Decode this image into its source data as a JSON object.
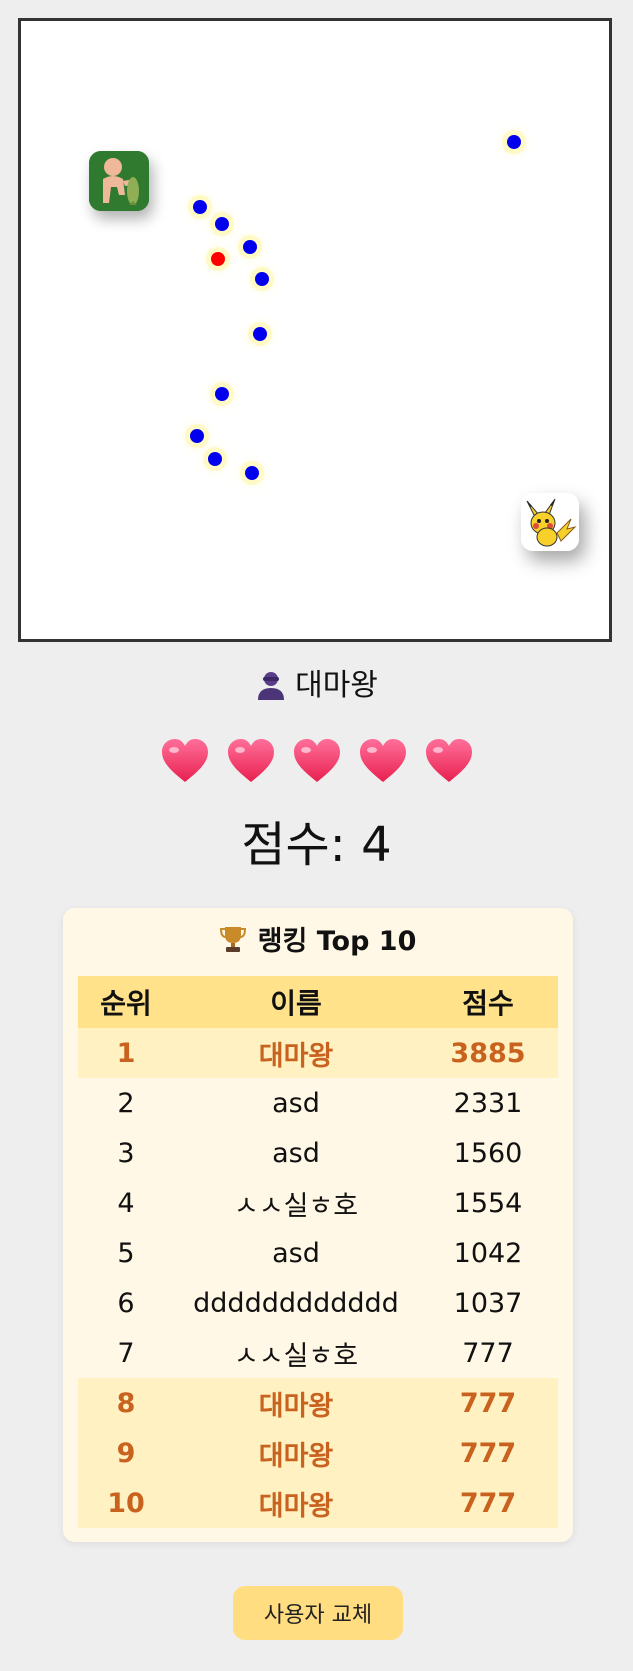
{
  "game": {
    "dots": [
      {
        "color": "blue"
      },
      {
        "color": "blue"
      },
      {
        "color": "blue"
      },
      {
        "color": "red"
      },
      {
        "color": "blue"
      },
      {
        "color": "blue"
      },
      {
        "color": "blue"
      },
      {
        "color": "blue"
      },
      {
        "color": "blue"
      },
      {
        "color": "blue"
      },
      {
        "color": "blue"
      },
      {
        "color": "blue"
      }
    ],
    "enemy_icon": "muscle-man-with-fish-icon",
    "player_icon": "pikachu-icon"
  },
  "user": {
    "icon": "user-silhouette-icon",
    "name": "대마왕"
  },
  "lives": {
    "count": 5,
    "icon": "heart-icon",
    "color": "#ff3b6b"
  },
  "score": {
    "label": "점수:",
    "value": "4"
  },
  "ranking": {
    "icon": "trophy-icon",
    "title": "랭킹 Top 10",
    "headers": {
      "rank": "순위",
      "name": "이름",
      "score": "점수"
    },
    "rows": [
      {
        "rank": "1",
        "name": "대마왕",
        "score": "3885",
        "highlight": true
      },
      {
        "rank": "2",
        "name": "asd",
        "score": "2331",
        "highlight": false
      },
      {
        "rank": "3",
        "name": "asd",
        "score": "1560",
        "highlight": false
      },
      {
        "rank": "4",
        "name": "ㅅㅅ실ㅎ호",
        "score": "1554",
        "highlight": false
      },
      {
        "rank": "5",
        "name": "asd",
        "score": "1042",
        "highlight": false
      },
      {
        "rank": "6",
        "name": "dddddddddddd",
        "score": "1037",
        "highlight": false
      },
      {
        "rank": "7",
        "name": "ㅅㅅ실ㅎ호",
        "score": "777",
        "highlight": false
      },
      {
        "rank": "8",
        "name": "대마왕",
        "score": "777",
        "highlight": true
      },
      {
        "rank": "9",
        "name": "대마왕",
        "score": "777",
        "highlight": true
      },
      {
        "rank": "10",
        "name": "대마왕",
        "score": "777",
        "highlight": true
      }
    ],
    "highlight_color": "#c8621e"
  },
  "switch_user_label": "사용자 교체"
}
